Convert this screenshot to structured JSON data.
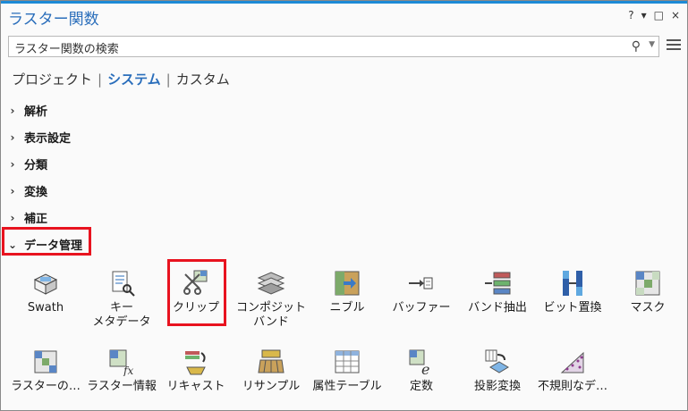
{
  "title": "ラスター関数",
  "window_controls": [
    "?",
    "▾",
    "□",
    "×"
  ],
  "search": {
    "placeholder": "ラスター関数の検索"
  },
  "tabs": [
    {
      "label": "プロジェクト"
    },
    {
      "label": "システム"
    },
    {
      "label": "カスタム"
    }
  ],
  "categories": [
    {
      "label": "解析"
    },
    {
      "label": "表示設定"
    },
    {
      "label": "分類"
    },
    {
      "label": "変換"
    },
    {
      "label": "補正"
    },
    {
      "label": "データ管理"
    }
  ],
  "tools_row1": [
    {
      "label": "Swath",
      "icon": "swath-icon"
    },
    {
      "label": "キー\nメタデータ",
      "icon": "key-metadata-icon"
    },
    {
      "label": "クリップ",
      "icon": "clip-icon"
    },
    {
      "label": "コンポジット\nバンド",
      "icon": "composite-band-icon"
    },
    {
      "label": "ニブル",
      "icon": "nibble-icon"
    },
    {
      "label": "バッファー",
      "icon": "buffer-icon"
    },
    {
      "label": "バンド抽出",
      "icon": "extract-band-icon"
    },
    {
      "label": "ビット置換",
      "icon": "bit-replace-icon"
    },
    {
      "label": "マスク",
      "icon": "mask-icon"
    }
  ],
  "tools_row2": [
    {
      "label": "ラスターの…",
      "icon": "raster-icon"
    },
    {
      "label": "ラスター情報",
      "icon": "raster-info-icon"
    },
    {
      "label": "リキャスト",
      "icon": "recast-icon"
    },
    {
      "label": "リサンプル",
      "icon": "resample-icon"
    },
    {
      "label": "属性テーブル",
      "icon": "attribute-table-icon"
    },
    {
      "label": "定数",
      "icon": "constant-icon"
    },
    {
      "label": "投影変換",
      "icon": "reproject-icon"
    },
    {
      "label": "不規則なデ…",
      "icon": "irregular-data-icon"
    }
  ]
}
